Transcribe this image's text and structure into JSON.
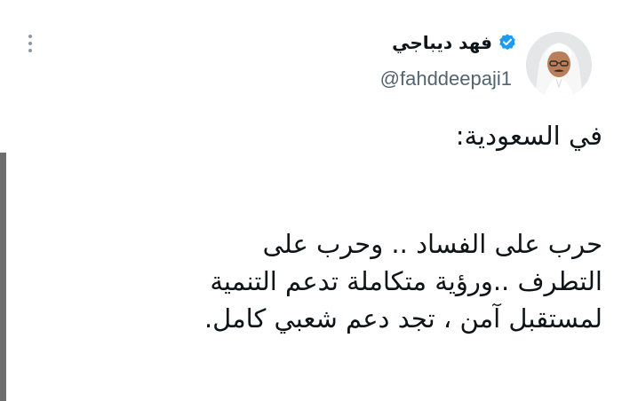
{
  "tweet": {
    "author": {
      "display_name": "فهد ديباجي",
      "handle": "@fahddeepaji1",
      "verified": true
    },
    "lines": [
      "في السعودية:",
      "حرب على الفساد .. وحرب على",
      "التطرف ..ورؤية متكاملة تدعم التنمية",
      "لمستقبل آمن ، تجد دعم شعبي كامل."
    ]
  },
  "icons": {
    "more": "more-vertical-icon",
    "verified": "verified-badge-icon",
    "avatar": "profile-photo"
  },
  "colors": {
    "text": "#0f1419",
    "secondary_text": "#536471",
    "verified_blue": "#1d9bf0",
    "background": "#ffffff"
  }
}
